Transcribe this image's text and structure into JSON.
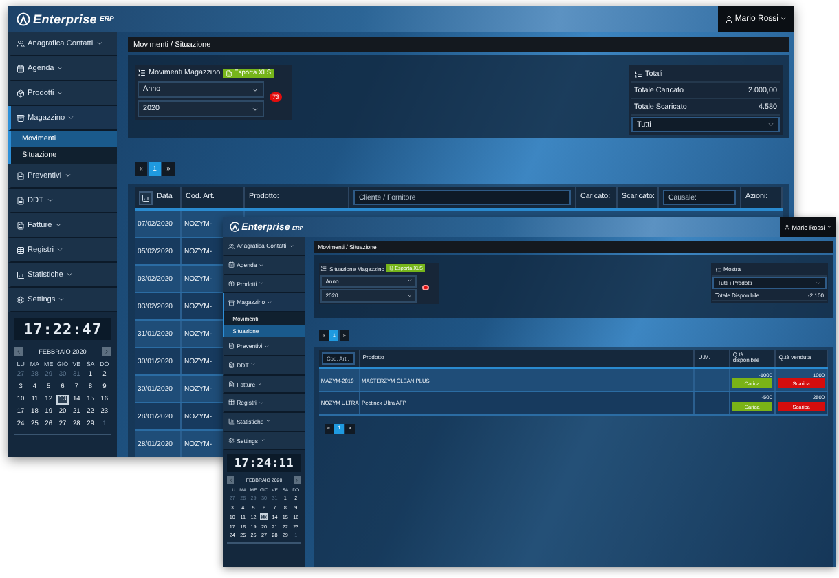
{
  "windows": [
    {
      "kind": "movimenti",
      "logo": {
        "name": "Enterprise",
        "sub": "ERP"
      },
      "user": "Mario Rossi",
      "menu": [
        {
          "label": "Anagrafica Contatti",
          "expanded": false
        },
        {
          "label": "Agenda",
          "expanded": false
        },
        {
          "label": "Prodotti",
          "expanded": false
        },
        {
          "label": "Magazzino",
          "expanded": true,
          "children": [
            {
              "label": "Movimenti",
              "selected": true
            },
            {
              "label": "Situazione",
              "selected": false
            }
          ]
        },
        {
          "label": "Preventivi",
          "expanded": false
        },
        {
          "label": "DDT",
          "expanded": false
        },
        {
          "label": "Fatture",
          "expanded": false
        },
        {
          "label": "Registri",
          "expanded": false
        },
        {
          "label": "Statistiche",
          "expanded": false
        },
        {
          "label": "Settings",
          "expanded": false
        }
      ],
      "clock": "17:22:47",
      "calendar": {
        "month": "FEBBRAIO 2020",
        "weekdays": [
          "LU",
          "MA",
          "ME",
          "GIO",
          "VE",
          "SA",
          "DO"
        ],
        "days": [
          {
            "d": "27",
            "muted": true,
            "today": false
          },
          {
            "d": "28",
            "muted": true,
            "today": false
          },
          {
            "d": "29",
            "muted": true,
            "today": false
          },
          {
            "d": "30",
            "muted": true,
            "today": false
          },
          {
            "d": "31",
            "muted": true,
            "today": false
          },
          {
            "d": "1",
            "muted": false,
            "today": false
          },
          {
            "d": "2",
            "muted": false,
            "today": false
          },
          {
            "d": "3",
            "muted": false,
            "today": false
          },
          {
            "d": "4",
            "muted": false,
            "today": false
          },
          {
            "d": "5",
            "muted": false,
            "today": false
          },
          {
            "d": "6",
            "muted": false,
            "today": false
          },
          {
            "d": "7",
            "muted": false,
            "today": false
          },
          {
            "d": "8",
            "muted": false,
            "today": false
          },
          {
            "d": "9",
            "muted": false,
            "today": false
          },
          {
            "d": "10",
            "muted": false,
            "today": false
          },
          {
            "d": "11",
            "muted": false,
            "today": false
          },
          {
            "d": "12",
            "muted": false,
            "today": false
          },
          {
            "d": "13",
            "muted": false,
            "today": true
          },
          {
            "d": "14",
            "muted": false,
            "today": false
          },
          {
            "d": "15",
            "muted": false,
            "today": false
          },
          {
            "d": "16",
            "muted": false,
            "today": false
          },
          {
            "d": "17",
            "muted": false,
            "today": false
          },
          {
            "d": "18",
            "muted": false,
            "today": false
          },
          {
            "d": "19",
            "muted": false,
            "today": false
          },
          {
            "d": "20",
            "muted": false,
            "today": false
          },
          {
            "d": "21",
            "muted": false,
            "today": false
          },
          {
            "d": "22",
            "muted": false,
            "today": false
          },
          {
            "d": "23",
            "muted": false,
            "today": false
          },
          {
            "d": "24",
            "muted": false,
            "today": false
          },
          {
            "d": "25",
            "muted": false,
            "today": false
          },
          {
            "d": "26",
            "muted": false,
            "today": false
          },
          {
            "d": "27",
            "muted": false,
            "today": false
          },
          {
            "d": "28",
            "muted": false,
            "today": false
          },
          {
            "d": "29",
            "muted": false,
            "today": false
          },
          {
            "d": "1",
            "muted": true,
            "today": false
          }
        ]
      },
      "breadcrumb": "Movimenti / Situazione",
      "filter": {
        "title": "Movimenti Magazzino",
        "export": "Esporta XLS",
        "selects": [
          "Anno",
          "2020"
        ],
        "badge": "73"
      },
      "summary": [
        {
          "kind": "title",
          "label": "Totali"
        },
        {
          "kind": "pair",
          "label": "Totale Caricato",
          "value": "2.000,00"
        },
        {
          "kind": "pair",
          "label": "Totale Scaricato",
          "value": "4.580"
        },
        {
          "kind": "select",
          "value": "Tutti"
        }
      ],
      "pagination": [
        {
          "label": "«",
          "selected": false
        },
        {
          "label": "1",
          "selected": true
        },
        {
          "label": "»",
          "selected": false
        }
      ],
      "columns": [
        {
          "kind": "sort",
          "label": "Data"
        },
        {
          "kind": "label",
          "label": "Cod. Art."
        },
        {
          "kind": "label",
          "label": "Prodotto:"
        },
        {
          "kind": "field",
          "placeholder": "Cliente / Fornitore"
        },
        {
          "kind": "label",
          "label": "Caricato:"
        },
        {
          "kind": "label",
          "label": "Scaricato:"
        },
        {
          "kind": "field",
          "placeholder": "Causale:"
        },
        {
          "kind": "label",
          "label": "Azioni:"
        }
      ],
      "rows": [
        {
          "cells": [
            {
              "text": "07/02/2020"
            },
            {
              "text": "NOZYM-"
            }
          ]
        },
        {
          "cells": [
            {
              "text": "05/02/2020"
            },
            {
              "text": "NOZYM-"
            }
          ]
        },
        {
          "cells": [
            {
              "text": "03/02/2020"
            },
            {
              "text": "NOZYM-"
            }
          ]
        },
        {
          "cells": [
            {
              "text": "03/02/2020"
            },
            {
              "text": "NOZYM-"
            }
          ]
        },
        {
          "cells": [
            {
              "text": "31/01/2020"
            },
            {
              "text": "NOZYM-"
            }
          ]
        },
        {
          "cells": [
            {
              "text": "30/01/2020"
            },
            {
              "text": "NOZYM-"
            }
          ]
        },
        {
          "cells": [
            {
              "text": "30/01/2020"
            },
            {
              "text": "NOZYM-"
            }
          ]
        },
        {
          "cells": [
            {
              "text": "28/01/2020"
            },
            {
              "text": "NOZYM-"
            }
          ]
        },
        {
          "cells": [
            {
              "text": "28/01/2020"
            },
            {
              "text": "NOZYM-"
            }
          ]
        }
      ]
    },
    {
      "kind": "situazione",
      "logo": {
        "name": "Enterprise",
        "sub": "ERP"
      },
      "user": "Mario Rossi",
      "menu": [
        {
          "label": "Anagrafica Contatti",
          "expanded": false
        },
        {
          "label": "Agenda",
          "expanded": false
        },
        {
          "label": "Prodotti",
          "expanded": false
        },
        {
          "label": "Magazzino",
          "expanded": true,
          "children": [
            {
              "label": "Movimenti",
              "selected": false
            },
            {
              "label": "Situazione",
              "selected": true
            }
          ]
        },
        {
          "label": "Preventivi",
          "expanded": false
        },
        {
          "label": "DDT",
          "expanded": false
        },
        {
          "label": "Fatture",
          "expanded": false
        },
        {
          "label": "Registri",
          "expanded": false
        },
        {
          "label": "Statistiche",
          "expanded": false
        },
        {
          "label": "Settings",
          "expanded": false
        }
      ],
      "clock": "17:24:11",
      "calendar": {
        "month": "FEBBRAIO 2020",
        "weekdays": [
          "LU",
          "MA",
          "ME",
          "GIO",
          "VE",
          "SA",
          "DO"
        ],
        "days": [
          {
            "d": "27",
            "muted": true,
            "today": false
          },
          {
            "d": "28",
            "muted": true,
            "today": false
          },
          {
            "d": "29",
            "muted": true,
            "today": false
          },
          {
            "d": "30",
            "muted": true,
            "today": false
          },
          {
            "d": "31",
            "muted": true,
            "today": false
          },
          {
            "d": "1",
            "muted": false,
            "today": false
          },
          {
            "d": "2",
            "muted": false,
            "today": false
          },
          {
            "d": "3",
            "muted": false,
            "today": false
          },
          {
            "d": "4",
            "muted": false,
            "today": false
          },
          {
            "d": "5",
            "muted": false,
            "today": false
          },
          {
            "d": "6",
            "muted": false,
            "today": false
          },
          {
            "d": "7",
            "muted": false,
            "today": false
          },
          {
            "d": "8",
            "muted": false,
            "today": false
          },
          {
            "d": "9",
            "muted": false,
            "today": false
          },
          {
            "d": "10",
            "muted": false,
            "today": false
          },
          {
            "d": "11",
            "muted": false,
            "today": false
          },
          {
            "d": "12",
            "muted": false,
            "today": false
          },
          {
            "d": "13",
            "muted": false,
            "today": true
          },
          {
            "d": "14",
            "muted": false,
            "today": false
          },
          {
            "d": "15",
            "muted": false,
            "today": false
          },
          {
            "d": "16",
            "muted": false,
            "today": false
          },
          {
            "d": "17",
            "muted": false,
            "today": false
          },
          {
            "d": "18",
            "muted": false,
            "today": false
          },
          {
            "d": "19",
            "muted": false,
            "today": false
          },
          {
            "d": "20",
            "muted": false,
            "today": false
          },
          {
            "d": "21",
            "muted": false,
            "today": false
          },
          {
            "d": "22",
            "muted": false,
            "today": false
          },
          {
            "d": "23",
            "muted": false,
            "today": false
          },
          {
            "d": "24",
            "muted": false,
            "today": false
          },
          {
            "d": "25",
            "muted": false,
            "today": false
          },
          {
            "d": "26",
            "muted": false,
            "today": false
          },
          {
            "d": "27",
            "muted": false,
            "today": false
          },
          {
            "d": "28",
            "muted": false,
            "today": false
          },
          {
            "d": "29",
            "muted": false,
            "today": false
          },
          {
            "d": "1",
            "muted": true,
            "today": false
          }
        ]
      },
      "breadcrumb": "Movimenti / Situazione",
      "filter": {
        "title": "Situazione Magazzino",
        "export": "Esporta XLS",
        "selects": [
          "Anno",
          "2020"
        ],
        "badge_dot": true
      },
      "summary": [
        {
          "kind": "title",
          "label": "Mostra"
        },
        {
          "kind": "select",
          "value": "Tutti i Prodotti"
        },
        {
          "kind": "pair",
          "label": "Totale Disponibile",
          "value": "-2.100"
        }
      ],
      "pagination": [
        {
          "label": "«",
          "selected": false
        },
        {
          "label": "1",
          "selected": true
        },
        {
          "label": "»",
          "selected": false
        }
      ],
      "columns": [
        {
          "kind": "field",
          "placeholder": "Cod. Art.."
        },
        {
          "kind": "label",
          "label": "Prodotto"
        },
        {
          "kind": "label",
          "label": "U.M."
        },
        {
          "kind": "label",
          "label": "Q.tà disponibile"
        },
        {
          "kind": "label",
          "label": "Q.tà venduta"
        }
      ],
      "rows": [
        {
          "cells": [
            {
              "text": "MAZYM-2019"
            },
            {
              "text": "MASTERZYM CLEAN PLUS"
            },
            {},
            {
              "text": "-1000",
              "action": "Carica",
              "kind": "load"
            },
            {
              "text": "1000",
              "action": "Scarica",
              "kind": "unload"
            }
          ]
        },
        {
          "cells": [
            {
              "text": "NOZYM ULTRA"
            },
            {
              "text": "Pectinex Ultra AFP"
            },
            {},
            {
              "text": "-500",
              "action": "Carica",
              "kind": "load"
            },
            {
              "text": "2500",
              "action": "Scarica",
              "kind": "unload"
            }
          ]
        }
      ],
      "bottom_pagination": [
        {
          "label": "«",
          "selected": false
        },
        {
          "label": "1",
          "selected": true
        },
        {
          "label": "»",
          "selected": false
        }
      ]
    }
  ]
}
